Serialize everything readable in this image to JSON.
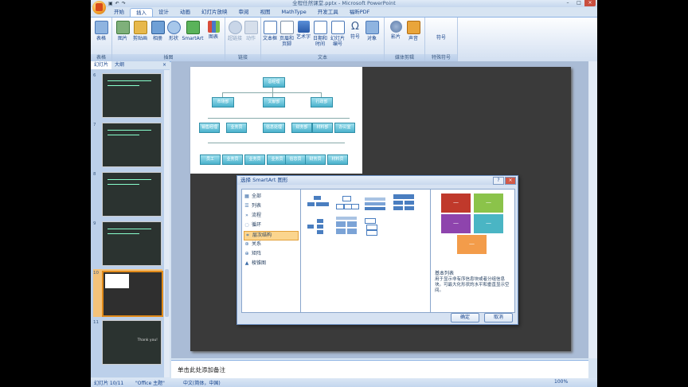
{
  "window": {
    "title": "全程任然课堂.pptx - Microsoft PowerPoint"
  },
  "tabs": [
    "开始",
    "插入",
    "设计",
    "动画",
    "幻灯片放映",
    "审阅",
    "视图",
    "MathType",
    "开发工具",
    "福昕PDF"
  ],
  "active_tab": "插入",
  "ribbon": {
    "groups": [
      {
        "label": "表格",
        "buttons": [
          "表格"
        ]
      },
      {
        "label": "插图",
        "buttons": [
          "图片",
          "剪贴画",
          "相册",
          "形状",
          "SmartArt",
          "图表"
        ]
      },
      {
        "label": "链接",
        "buttons": [
          "超链接",
          "动作"
        ]
      },
      {
        "label": "文本",
        "buttons": [
          "文本框",
          "页眉和页脚",
          "艺术字",
          "日期和时间",
          "幻灯片编号",
          "符号",
          "对象"
        ]
      },
      {
        "label": "媒体剪辑",
        "buttons": [
          "影片",
          "声音"
        ]
      },
      {
        "label": "特殊符号",
        "buttons": [
          "符号"
        ]
      }
    ]
  },
  "slides_panel": {
    "tabs": [
      "幻灯片",
      "大纲"
    ],
    "close": "×",
    "numbers": [
      "6",
      "7",
      "8",
      "9",
      "10",
      "11"
    ],
    "selected": "10",
    "last_thumb_text": "Thank you!"
  },
  "org_chart": {
    "top": "总经理",
    "level2": [
      "市场部",
      "文献部",
      "行政部"
    ],
    "level3": [
      "销售经理",
      "业务员",
      "信息处理",
      "财务部",
      "材料部",
      "办公室"
    ],
    "level4": [
      "员工",
      "业务员",
      "业务员",
      "业务员",
      "信息员",
      "财务员",
      "材料员"
    ]
  },
  "dialog": {
    "title": "选择 SmartArt 图形",
    "controls": [
      "?",
      "×"
    ],
    "categories": [
      {
        "icon": "grid-icon",
        "glyph": "▦",
        "label": "全部"
      },
      {
        "icon": "list-icon",
        "glyph": "☰",
        "label": "列表"
      },
      {
        "icon": "process-icon",
        "glyph": "»",
        "label": "流程"
      },
      {
        "icon": "cycle-icon",
        "glyph": "◌",
        "label": "循环"
      },
      {
        "icon": "hierarchy-icon",
        "glyph": "⌗",
        "label": "层次结构"
      },
      {
        "icon": "relation-icon",
        "glyph": "⊛",
        "label": "关系"
      },
      {
        "icon": "matrix-icon",
        "glyph": "⊕",
        "label": "矩阵"
      },
      {
        "icon": "pyramid-icon",
        "glyph": "▲",
        "label": "棱锥图"
      }
    ],
    "selected_category": "层次结构",
    "preview": {
      "title": "基本列表",
      "description": "用于显示非有序信息块或者分组信息块。可最大化形状的水平和垂直显示空间。",
      "box_labels": [
        "—",
        "—",
        "—",
        "—",
        "—"
      ],
      "colors": [
        "#c0392b",
        "#8bc34a",
        "#8e44ad",
        "#4ab5c4",
        "#f39c4a"
      ]
    },
    "ok": "确定",
    "cancel": "取消"
  },
  "notes": {
    "placeholder": "单击此处添加备注"
  },
  "statusbar": {
    "slide_info": "幻灯片 10/11",
    "theme": "\"Office 主题\"",
    "language": "中文(简体，中国)",
    "zoom": "100%"
  }
}
